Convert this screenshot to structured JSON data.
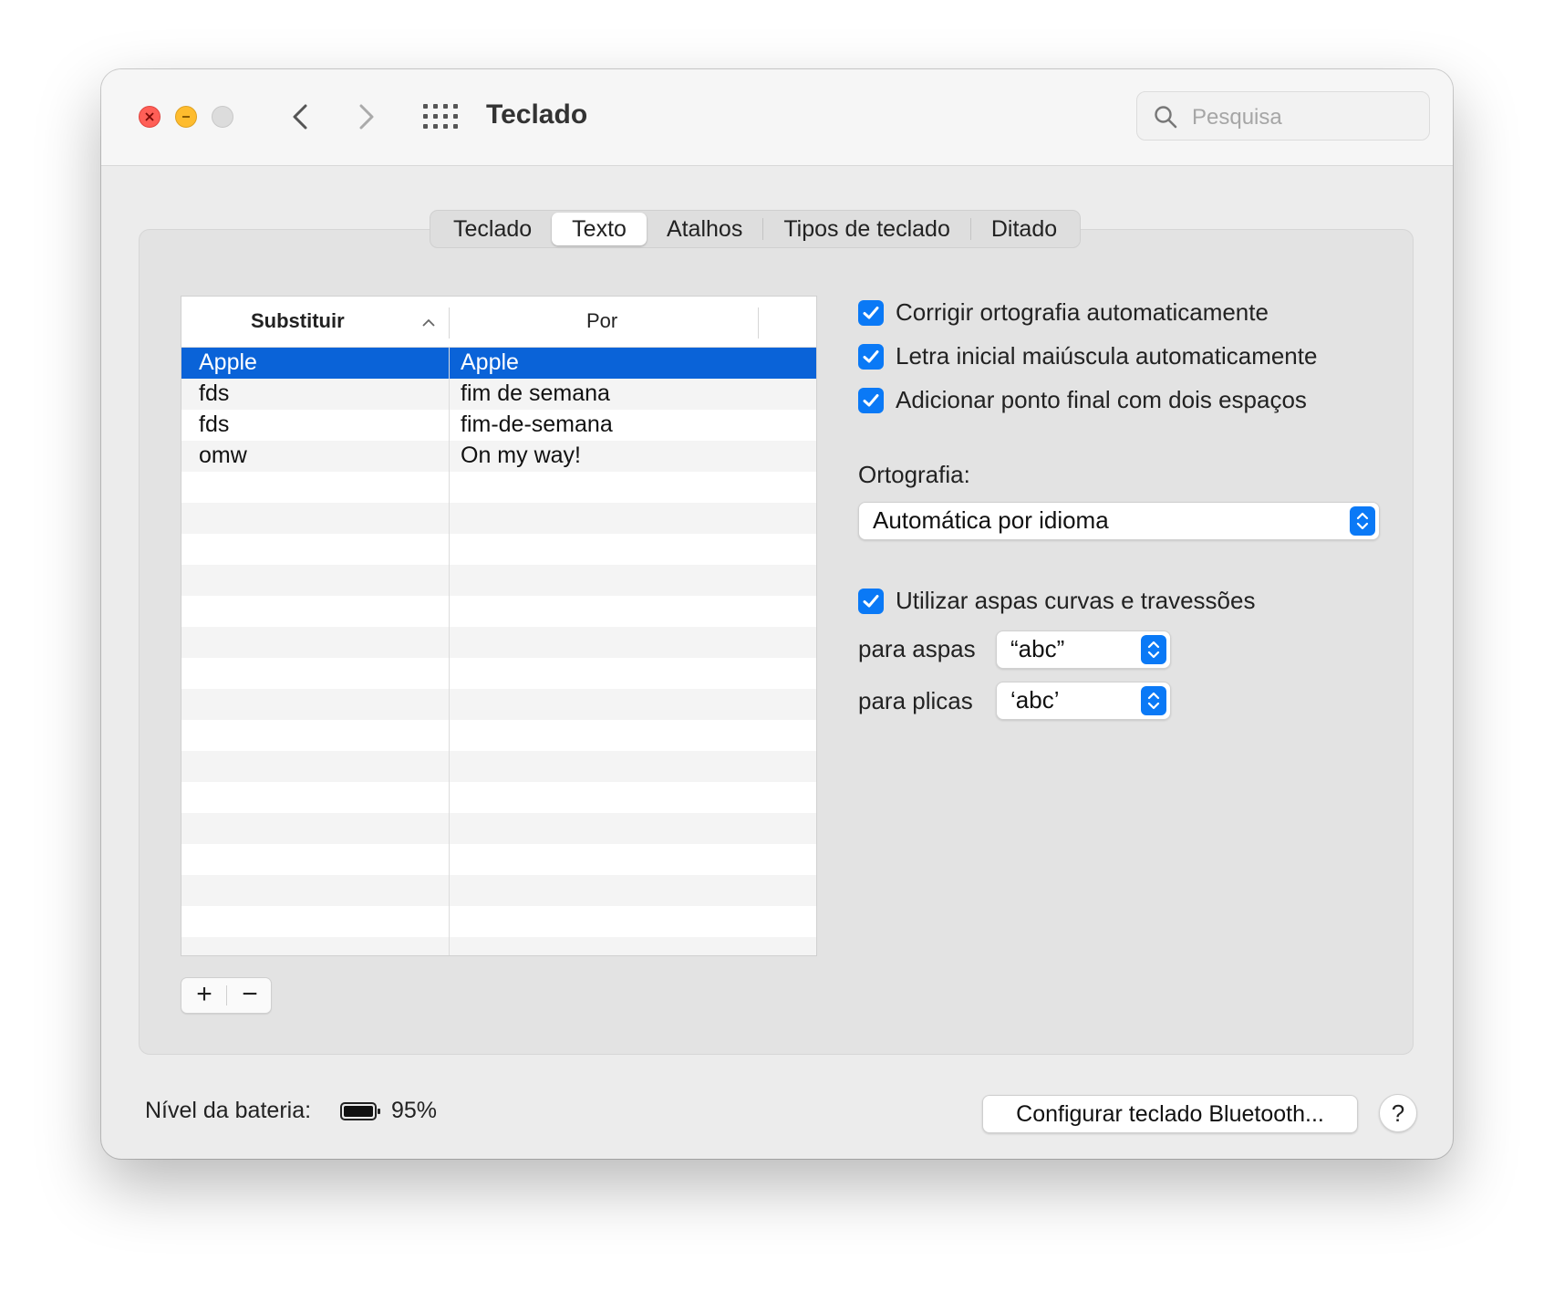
{
  "window": {
    "title": "Teclado",
    "search_placeholder": "Pesquisa"
  },
  "tabs": [
    {
      "label": "Teclado",
      "active": false
    },
    {
      "label": "Texto",
      "active": true
    },
    {
      "label": "Atalhos",
      "active": false
    },
    {
      "label": "Tipos de teclado",
      "active": false
    },
    {
      "label": "Ditado",
      "active": false
    }
  ],
  "table": {
    "col1_header": "Substituir",
    "col2_header": "Por",
    "rows": [
      {
        "replace": "Apple",
        "with": "Apple",
        "selected": true
      },
      {
        "replace": "fds",
        "with": "fim de semana",
        "selected": false
      },
      {
        "replace": "fds",
        "with": "fim-de-semana",
        "selected": false
      },
      {
        "replace": "omw",
        "with": "On my way!",
        "selected": false
      }
    ],
    "add_label": "+",
    "remove_label": "−"
  },
  "options": {
    "auto_correct": {
      "label": "Corrigir ortografia automaticamente",
      "checked": true
    },
    "auto_capitalize": {
      "label": "Letra inicial maiúscula automaticamente",
      "checked": true
    },
    "double_space_period": {
      "label": "Adicionar ponto final com dois espaços",
      "checked": true
    },
    "spelling_label": "Ortografia:",
    "spelling_value": "Automática por idioma",
    "smart_quotes": {
      "label": "Utilizar aspas curvas e travessões",
      "checked": true
    },
    "double_quotes_label": "para aspas",
    "double_quotes_value": "“abc”",
    "single_quotes_label": "para plicas",
    "single_quotes_value": "‘abc’"
  },
  "footer": {
    "battery_label": "Nível da bateria:",
    "battery_level": "95%",
    "bluetooth_button": "Configurar teclado Bluetooth...",
    "help_label": "?"
  },
  "colors": {
    "accent": "#0a79f6",
    "selection": "#0a63d8",
    "close": "#ff5f57",
    "minimize": "#febc2e"
  }
}
